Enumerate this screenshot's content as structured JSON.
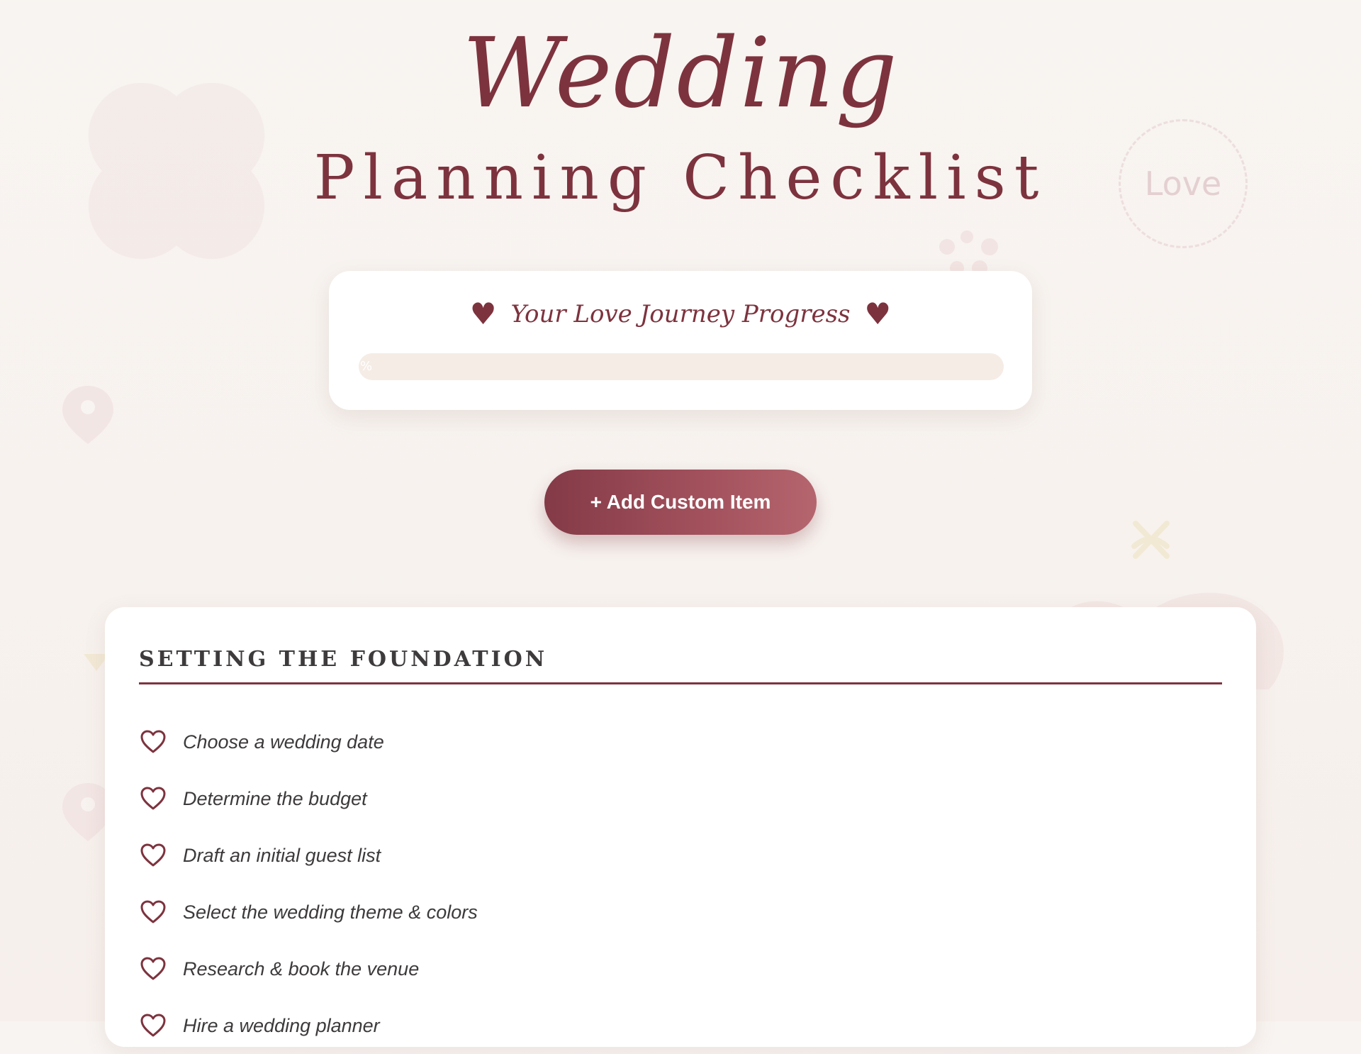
{
  "header": {
    "title_script": "Wedding",
    "title_main": "Planning Checklist"
  },
  "decor": {
    "love_badge": "Love"
  },
  "progress": {
    "title": "Your Love Journey Progress",
    "percent": 0,
    "percent_label": "%"
  },
  "actions": {
    "add_custom_item": "+ Add Custom Item"
  },
  "section": {
    "title": "SETTING THE FOUNDATION",
    "items": [
      {
        "label": "Choose a wedding date",
        "checked": false
      },
      {
        "label": "Determine the budget",
        "checked": false
      },
      {
        "label": "Draft an initial guest list",
        "checked": false
      },
      {
        "label": "Select the wedding theme & colors",
        "checked": false
      },
      {
        "label": "Research & book the venue",
        "checked": false
      },
      {
        "label": "Hire a wedding planner",
        "checked": false
      }
    ]
  },
  "colors": {
    "accent": "#7d333e",
    "background": "#f8f4f1",
    "card": "#ffffff",
    "track": "#f5ece6",
    "text": "#3d3a3b"
  }
}
